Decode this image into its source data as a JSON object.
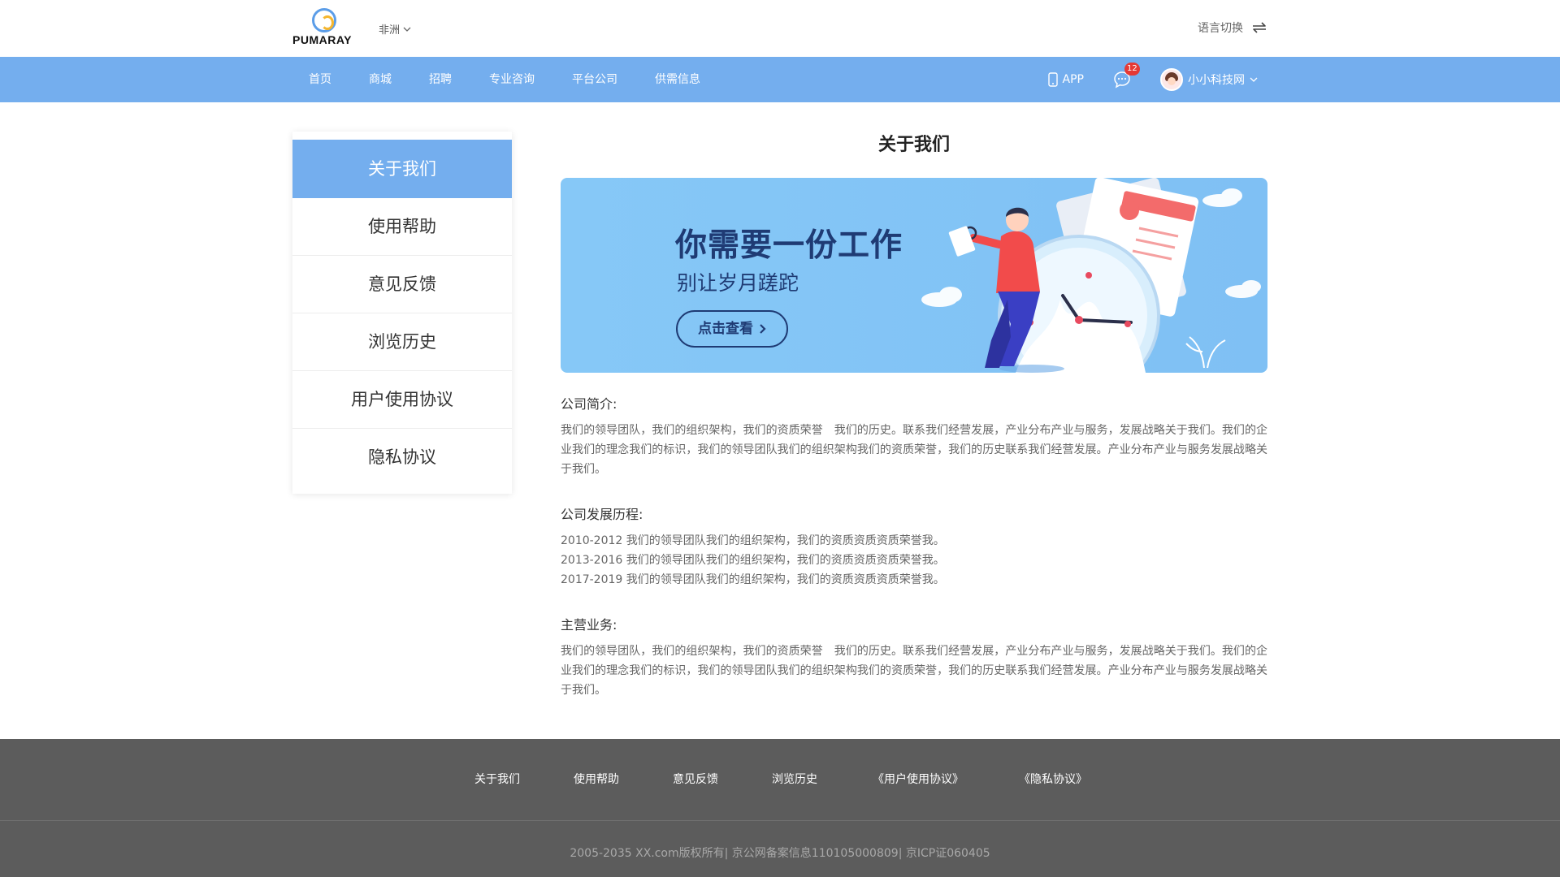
{
  "header": {
    "logo_text": "PUMARAY",
    "region": "非洲",
    "language_switch": "语言切换"
  },
  "nav": {
    "items": [
      "首页",
      "商城",
      "招聘",
      "专业咨询",
      "平台公司",
      "供需信息"
    ],
    "app_label": "APP",
    "message_count": "12",
    "username": "小小科技网"
  },
  "sidebar": {
    "items": [
      "关于我们",
      "使用帮助",
      "意见反馈",
      "浏览历史",
      "用户使用协议",
      "隐私协议"
    ],
    "active_index": 0
  },
  "main": {
    "title": "关于我们",
    "banner": {
      "headline": "你需要一份工作",
      "subline": "别让岁月蹉跎",
      "button": "点击查看"
    },
    "sections": [
      {
        "title": "公司简介:",
        "paragraphs": [
          "我们的领导团队，我们的组织架构，我们的资质荣誉　我们的历史。联系我们经营发展，产业分布产业与服务，发展战略关于我们。我们的企业我们的理念我们的标识，我们的领导团队我们的组织架构我们的资质荣誉，我们的历史联系我们经营发展。产业分布产业与服务发展战略关于我们。"
        ]
      },
      {
        "title": "公司发展历程:",
        "paragraphs": [
          "2010-2012 我们的领导团队我们的组织架构，我们的资质资质资质荣誉我。",
          "2013-2016 我们的领导团队我们的组织架构，我们的资质资质资质荣誉我。",
          "2017-2019 我们的领导团队我们的组织架构，我们的资质资质资质荣誉我。"
        ]
      },
      {
        "title": "主营业务:",
        "paragraphs": [
          "我们的领导团队，我们的组织架构，我们的资质荣誉　我们的历史。联系我们经营发展，产业分布产业与服务，发展战略关于我们。我们的企业我们的理念我们的标识，我们的领导团队我们的组织架构我们的资质荣誉，我们的历史联系我们经营发展。产业分布产业与服务发展战略关于我们。"
        ]
      }
    ]
  },
  "footer": {
    "links": [
      "关于我们",
      "使用帮助",
      "意见反馈",
      "浏览历史",
      "《用户使用协议》",
      "《隐私协议》"
    ],
    "copyright": "2005-2035 XX.com版权所有| 京公网备案信息110105000809| 京ICP证060405"
  },
  "colors": {
    "primary": "#74aeee",
    "footer_bg": "#5c5c5c",
    "banner_text": "#1f3b74",
    "badge": "#e53935"
  },
  "icons": {
    "region_dropdown": "chevron-down-icon",
    "language": "swap-icon",
    "app": "phone-icon",
    "message": "chat-bubble-icon",
    "user_dropdown": "chevron-down-icon"
  }
}
